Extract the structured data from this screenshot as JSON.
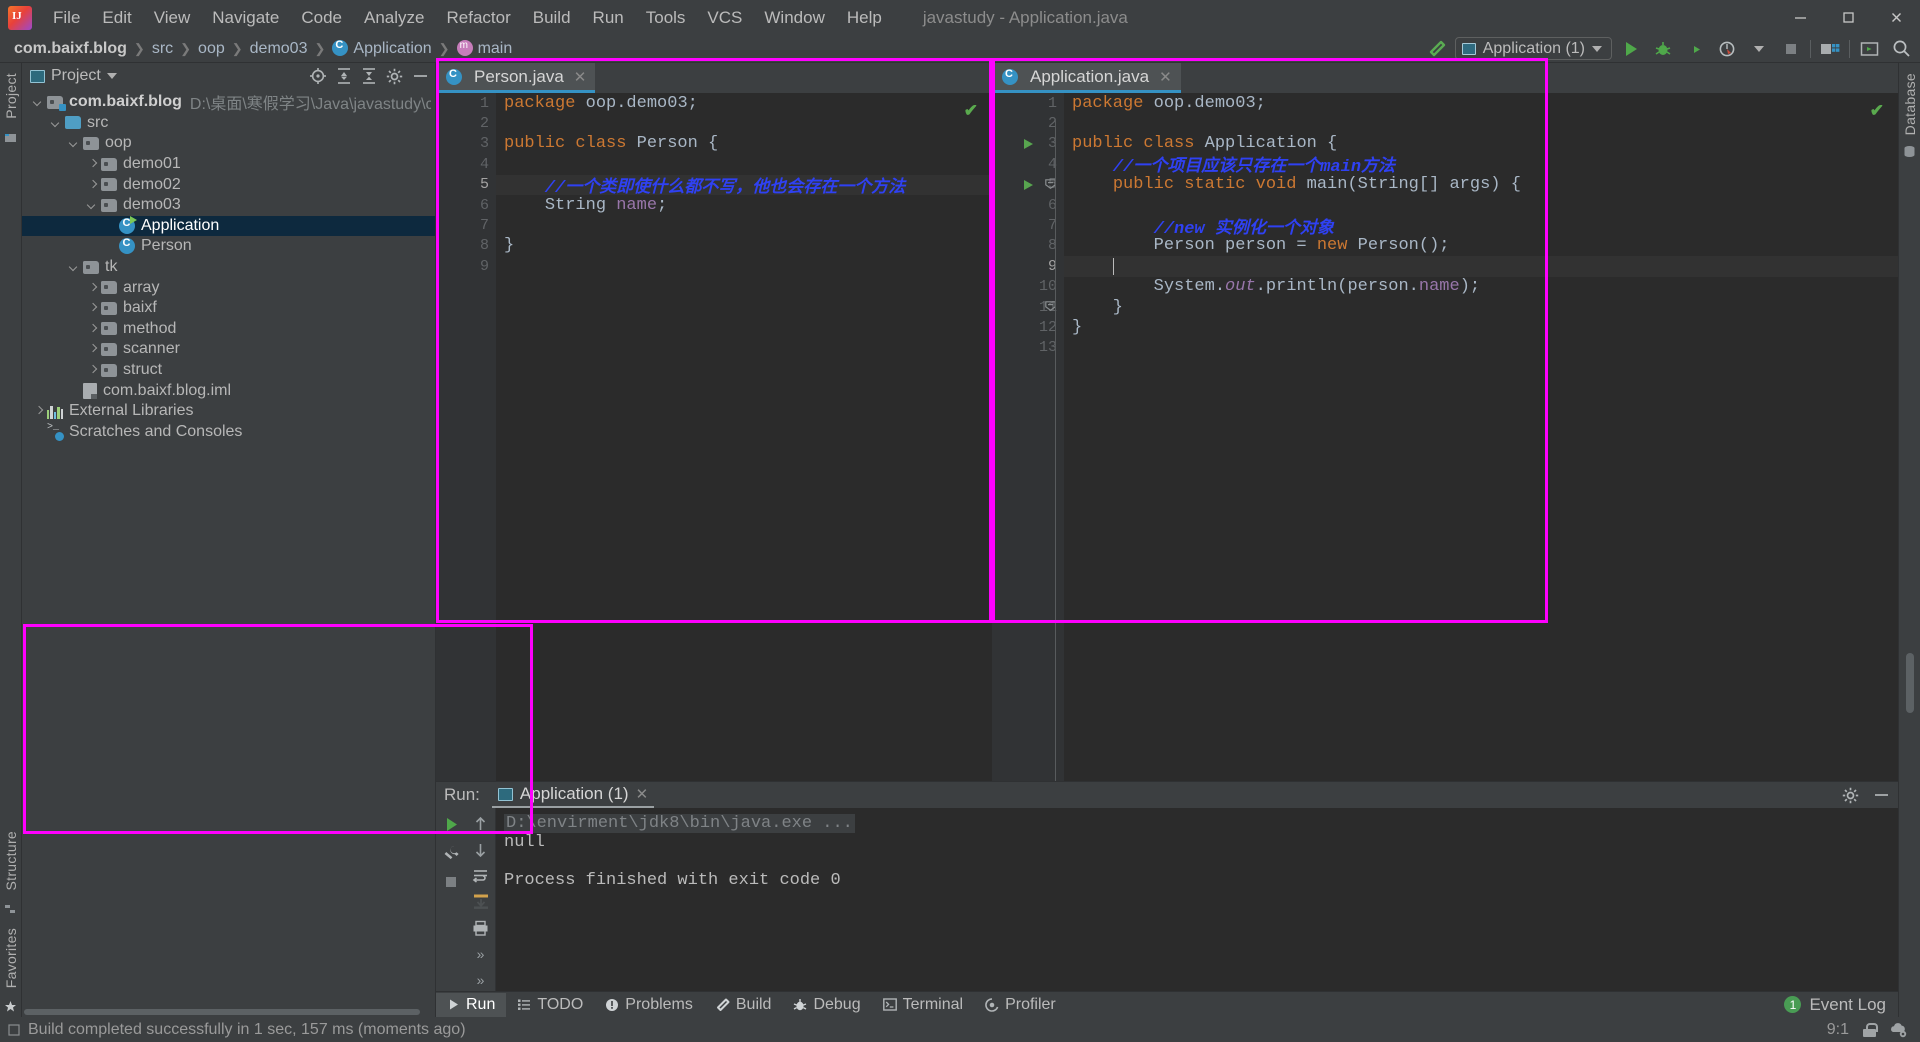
{
  "window": {
    "title": "javastudy - Application.java",
    "minimize_label": "—",
    "maximize_label": "❐",
    "close_label": "✕"
  },
  "menu": {
    "items": [
      "File",
      "Edit",
      "View",
      "Navigate",
      "Code",
      "Analyze",
      "Refactor",
      "Build",
      "Run",
      "Tools",
      "VCS",
      "Window",
      "Help"
    ]
  },
  "breadcrumb": {
    "segments": [
      "com.baixf.blog",
      "src",
      "oop",
      "demo03",
      "Application",
      "main"
    ],
    "separator": "❯"
  },
  "toolbar": {
    "build_icon": "hammer-icon",
    "run_config_name": "Application (1)",
    "run_label": "▶",
    "debug_label": "debug-icon",
    "coverage_label": "run-with-coverage-icon",
    "profile_label": "profiler-icon",
    "stop_label": "■",
    "git_label": "vcs-icon",
    "layout_label": "layout-icon",
    "search_label": "search-icon"
  },
  "left_rail": {
    "project_label": "Project",
    "structure_label": "Structure",
    "favorites_label": "Favorites"
  },
  "right_rail": {
    "database_label": "Database"
  },
  "project_window": {
    "title": "Project",
    "dropdown": "▾",
    "actions": [
      "locate-icon",
      "expand-all-icon",
      "collapse-all-icon",
      "settings-icon",
      "hide-icon"
    ],
    "tree": [
      {
        "indent": 0,
        "arrow": "open",
        "icon": "module-folder-icon",
        "label": "com.baixf.blog",
        "bold": true,
        "path": "D:\\桌面\\寒假学习\\Java\\javastudy\\com.baixf.blo",
        "selected": false
      },
      {
        "indent": 1,
        "arrow": "open",
        "icon": "source-folder-icon",
        "label": "src",
        "selected": false
      },
      {
        "indent": 2,
        "arrow": "open",
        "icon": "package-icon",
        "label": "oop",
        "selected": false
      },
      {
        "indent": 3,
        "arrow": "closed",
        "icon": "package-icon",
        "label": "demo01",
        "selected": false
      },
      {
        "indent": 3,
        "arrow": "closed",
        "icon": "package-icon",
        "label": "demo02",
        "selected": false
      },
      {
        "indent": 3,
        "arrow": "open",
        "icon": "package-icon",
        "label": "demo03",
        "selected": false
      },
      {
        "indent": 4,
        "arrow": "none",
        "icon": "class-runnable-icon",
        "label": "Application",
        "selected": true
      },
      {
        "indent": 4,
        "arrow": "none",
        "icon": "class-icon",
        "label": "Person",
        "selected": false
      },
      {
        "indent": 2,
        "arrow": "open",
        "icon": "package-icon",
        "label": "tk",
        "selected": false
      },
      {
        "indent": 3,
        "arrow": "closed",
        "icon": "package-icon",
        "label": "array",
        "selected": false
      },
      {
        "indent": 3,
        "arrow": "closed",
        "icon": "package-icon",
        "label": "baixf",
        "selected": false
      },
      {
        "indent": 3,
        "arrow": "closed",
        "icon": "package-icon",
        "label": "method",
        "selected": false
      },
      {
        "indent": 3,
        "arrow": "closed",
        "icon": "package-icon",
        "label": "scanner",
        "selected": false
      },
      {
        "indent": 3,
        "arrow": "closed",
        "icon": "package-icon",
        "label": "struct",
        "selected": false
      },
      {
        "indent": 2,
        "arrow": "none",
        "icon": "iml-file-icon",
        "label": "com.baixf.blog.iml",
        "selected": false
      },
      {
        "indent": 0,
        "arrow": "closed",
        "icon": "libraries-icon",
        "label": "External Libraries",
        "selected": false
      },
      {
        "indent": 0,
        "arrow": "none",
        "icon": "scratches-icon",
        "label": "Scratches and Consoles",
        "selected": false
      }
    ]
  },
  "editor_left": {
    "tab_label": "Person.java",
    "tab_close": "✕",
    "inspection_status": "✔",
    "line_numbers": [
      "1",
      "2",
      "3",
      "4",
      "5",
      "6",
      "7",
      "8",
      "9"
    ],
    "highlight_line": 5,
    "lines": [
      {
        "n": 1,
        "segments": [
          {
            "t": "package ",
            "c": "kw"
          },
          {
            "t": "oop.demo03",
            "c": "ty"
          },
          {
            "t": ";",
            "c": "ty"
          }
        ]
      },
      {
        "n": 2,
        "segments": []
      },
      {
        "n": 3,
        "segments": [
          {
            "t": "public class ",
            "c": "kw"
          },
          {
            "t": "Person ",
            "c": "ty"
          },
          {
            "t": "{",
            "c": "ty"
          }
        ]
      },
      {
        "n": 4,
        "segments": []
      },
      {
        "n": 5,
        "segments": [
          {
            "t": "    //一个类即使什么都不写，他也会存在一个方法",
            "c": "cm"
          }
        ]
      },
      {
        "n": 6,
        "segments": [
          {
            "t": "    ",
            "c": "ty"
          },
          {
            "t": "String ",
            "c": "ty"
          },
          {
            "t": "name",
            "c": "fld"
          },
          {
            "t": ";",
            "c": "ty"
          }
        ]
      },
      {
        "n": 7,
        "segments": []
      },
      {
        "n": 8,
        "segments": [
          {
            "t": "}",
            "c": "ty"
          }
        ]
      },
      {
        "n": 9,
        "segments": []
      }
    ]
  },
  "editor_right": {
    "tab_label": "Application.java",
    "tab_close": "✕",
    "inspection_status": "✔",
    "line_numbers": [
      "1",
      "2",
      "3",
      "4",
      "5",
      "6",
      "7",
      "8",
      "9",
      "10",
      "11",
      "12",
      "13"
    ],
    "run_marker_lines": [
      3,
      5
    ],
    "fold_marker_lines": [
      5,
      11
    ],
    "highlight_line": 9,
    "caret_line": 9,
    "lines": [
      {
        "n": 1,
        "segments": [
          {
            "t": "package ",
            "c": "kw"
          },
          {
            "t": "oop.demo03",
            "c": "ty"
          },
          {
            "t": ";",
            "c": "ty"
          }
        ]
      },
      {
        "n": 2,
        "segments": []
      },
      {
        "n": 3,
        "segments": [
          {
            "t": "public class ",
            "c": "kw"
          },
          {
            "t": "Application ",
            "c": "ty"
          },
          {
            "t": "{",
            "c": "ty"
          }
        ]
      },
      {
        "n": 4,
        "segments": [
          {
            "t": "    //一个项目应该只存在一个main方法",
            "c": "cm"
          }
        ]
      },
      {
        "n": 5,
        "segments": [
          {
            "t": "    ",
            "c": "ty"
          },
          {
            "t": "public static void ",
            "c": "kw"
          },
          {
            "t": "main",
            "c": "ty"
          },
          {
            "t": "(String[] args) {",
            "c": "ty"
          }
        ]
      },
      {
        "n": 6,
        "segments": []
      },
      {
        "n": 7,
        "segments": [
          {
            "t": "        //new 实例化一个对象",
            "c": "cm"
          }
        ]
      },
      {
        "n": 8,
        "segments": [
          {
            "t": "        Person person = ",
            "c": "ty"
          },
          {
            "t": "new ",
            "c": "kw"
          },
          {
            "t": "Person();",
            "c": "ty"
          }
        ]
      },
      {
        "n": 9,
        "segments": []
      },
      {
        "n": 10,
        "segments": [
          {
            "t": "        System.",
            "c": "ty"
          },
          {
            "t": "out",
            "c": "sf"
          },
          {
            "t": ".println(person.",
            "c": "ty"
          },
          {
            "t": "name",
            "c": "fld"
          },
          {
            "t": ");",
            "c": "ty"
          }
        ]
      },
      {
        "n": 11,
        "segments": [
          {
            "t": "    }",
            "c": "ty"
          }
        ]
      },
      {
        "n": 12,
        "segments": [
          {
            "t": "}",
            "c": "ty"
          }
        ]
      },
      {
        "n": 13,
        "segments": []
      }
    ]
  },
  "run_window": {
    "label": "Run:",
    "tab_label": "Application (1)",
    "tab_close": "✕",
    "actions": [
      "settings-icon",
      "hide-icon"
    ],
    "rail_left": [
      "rerun-icon",
      "wrench-icon",
      "stop-icon"
    ],
    "rail_right": [
      "up-icon",
      "down-icon",
      "soft-wrap-icon",
      "scroll-to-end-icon",
      "print-icon",
      "more-icon",
      "more2-icon"
    ],
    "console": {
      "command": "D:\\envirment\\jdk8\\bin\\java.exe ...",
      "output_lines": [
        "null",
        "",
        "Process finished with exit code 0"
      ]
    }
  },
  "bottom_bar": {
    "items": [
      {
        "label": "Run",
        "icon": "run-icon",
        "active": true
      },
      {
        "label": "TODO",
        "icon": "todo-icon",
        "active": false
      },
      {
        "label": "Problems",
        "icon": "problems-icon",
        "active": false
      },
      {
        "label": "Build",
        "icon": "hammer-icon",
        "active": false
      },
      {
        "label": "Debug",
        "icon": "bug-icon",
        "active": false
      },
      {
        "label": "Terminal",
        "icon": "terminal-icon",
        "active": false
      },
      {
        "label": "Profiler",
        "icon": "profiler-icon",
        "active": false
      }
    ],
    "event_log": {
      "label": "Event Log",
      "count": "1"
    }
  },
  "status_bar": {
    "message": "Build completed successfully in 1 sec, 157 ms (moments ago)",
    "caret_position": "9:1",
    "lock_icon": "unlocked-icon",
    "ide_icon": "ide-settings-icon"
  },
  "colors": {
    "accent": "#3592c4",
    "highlight_frame": "#ff00ff",
    "keyword": "#cc7832",
    "comment": "#2f41f3",
    "field": "#9876aa",
    "green": "#499c54",
    "selection": "#0d293e"
  }
}
